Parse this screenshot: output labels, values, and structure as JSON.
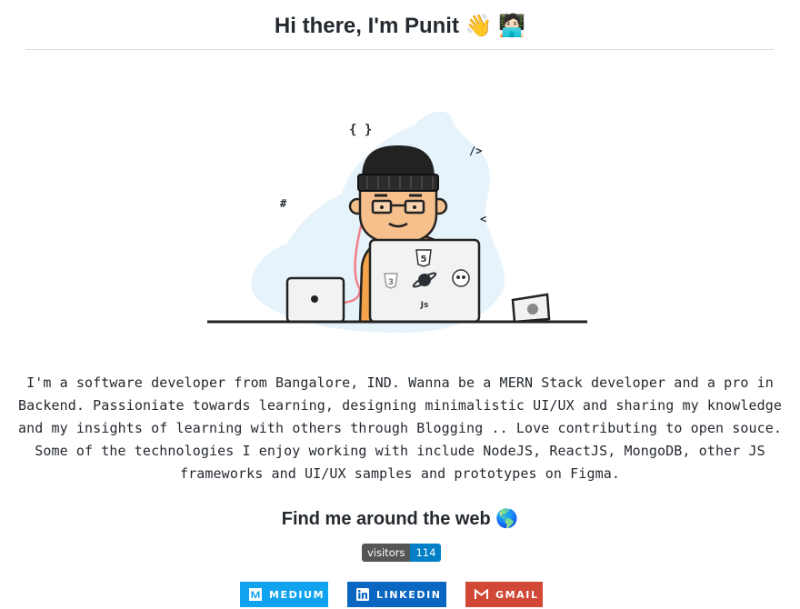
{
  "header": {
    "title": "Hi there, I'm Punit 👋 🧑🏻‍💻"
  },
  "hero": {
    "glyphs": {
      "braces": "{ }",
      "close_tag": "/>",
      "hash": "#",
      "chevron": "<",
      "html5": "5",
      "css3": "3",
      "js": "Js"
    }
  },
  "bio": {
    "lines": [
      "I'm a software developer from Bangalore, IND. Wanna be a MERN Stack developer and a pro in",
      "Backend. Passioniate towards learning, designing minimalistic UI/UX and sharing my knowledge",
      "and my insights of learning with others through Blogging .. Love contributing to open souce.",
      "Some of the technologies I enjoy working with include NodeJS, ReactJS, MongoDB, other JS",
      "frameworks and UI/UX samples and prototypes on Figma."
    ]
  },
  "socials": {
    "heading": "Find me around the web 🌎",
    "visitors": {
      "label": "visitors",
      "count": "114"
    },
    "badges": [
      {
        "label": "MEDIUM",
        "color": "#12a3ee",
        "icon": "medium-icon"
      },
      {
        "label": "LINKEDIN",
        "color": "#0b66c2",
        "icon": "linkedin-icon"
      },
      {
        "label": "GMAIL",
        "color": "#d14836",
        "icon": "gmail-icon"
      }
    ]
  },
  "colors": {
    "blob": "#e7f3fb",
    "text": "#24292f",
    "rule": "#d8dee4"
  }
}
